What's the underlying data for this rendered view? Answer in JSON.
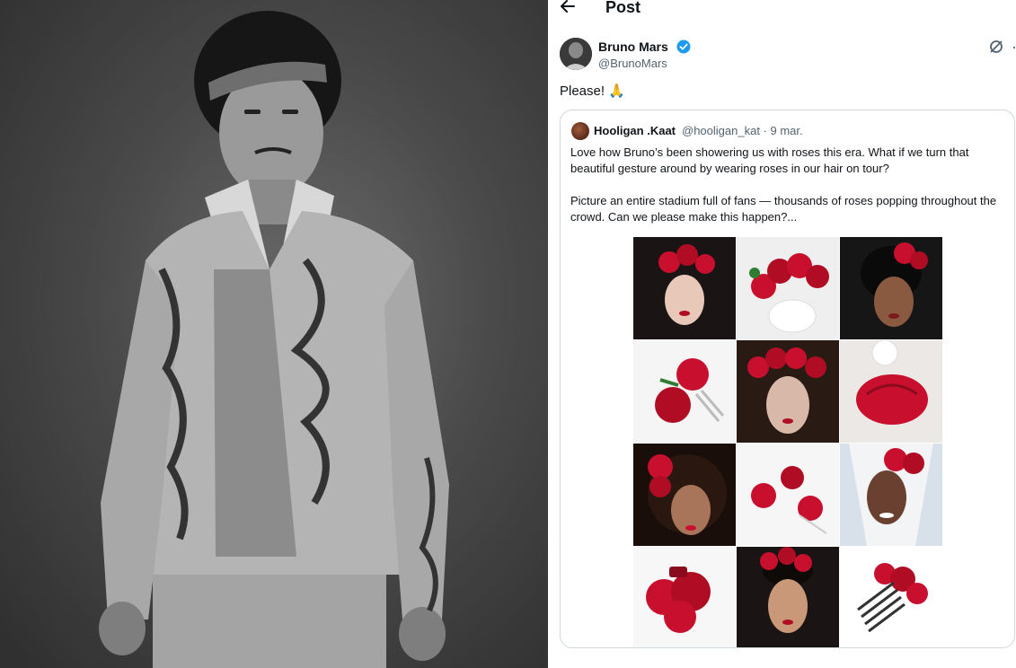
{
  "header": {
    "title": "Post"
  },
  "author": {
    "name": "Bruno Mars",
    "handle": "@BrunoMars"
  },
  "post": {
    "text": "Please! 🙏"
  },
  "quote": {
    "name": "Hooligan .Kaat",
    "handle_date": "@hooligan_kat · 9 mar.",
    "text": "Love how Bruno’s been showering us with roses this era. What if we turn that beautiful gesture around by wearing roses in our hair on tour?\n\nPicture an entire stadium full of fans — thousands of roses popping throughout the crowd. Can we please make this happen?..."
  },
  "icons": {
    "back": "arrow-left-icon",
    "verified": "verified-badge-icon",
    "grok": "grok-icon",
    "more": "more-icon"
  },
  "colors": {
    "verified": "#1d9bf0",
    "rose": "#c8102e",
    "border": "#cfd9de",
    "muted": "#536471"
  },
  "grid": {
    "tiles": [
      "woman-with-rose-crown",
      "rose-headband-product",
      "woman-with-rose-hair-clip",
      "rose-hair-comb-product",
      "woman-with-rose-crown-2",
      "rose-hair-clip-product",
      "woman-with-roses-curly-hair",
      "rose-hair-pins-product",
      "bride-with-roses",
      "rose-claw-clip-product",
      "woman-with-rose-updo",
      "rose-comb-product"
    ]
  }
}
